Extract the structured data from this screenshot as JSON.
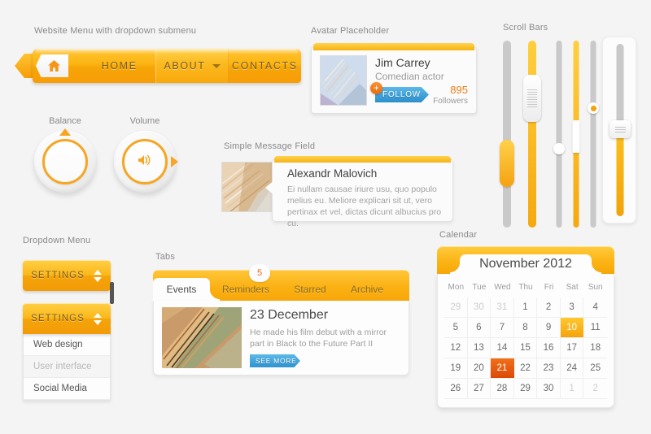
{
  "labels": {
    "menu": "Website Menu with dropdown submenu",
    "avatar": "Avatar Placeholder",
    "scrollbars": "Scroll Bars",
    "balance": "Balance",
    "volume": "Volume",
    "message": "Simple Message Field",
    "dropdown": "Dropdown Menu",
    "tabs": "Tabs",
    "calendar": "Calendar"
  },
  "menu": {
    "home_icon": "home-icon",
    "items": [
      {
        "label": "HOME",
        "active": false,
        "caret": false
      },
      {
        "label": "ABOUT",
        "active": true,
        "caret": true
      },
      {
        "label": "CONTACTS",
        "active": false,
        "caret": false
      }
    ]
  },
  "avatar": {
    "name": "Jim Carrey",
    "role": "Comedian actor",
    "follow_label": "FOLLOW",
    "plus_icon": "+",
    "followers_count": "895",
    "followers_label": "Followers"
  },
  "message": {
    "name": "Alexandr Malovich",
    "text": "Ei nullam causae iriure usu, quo populo melius eu. Meliore explicari sit ut, vero pertinax et vel, dictas dicunt albucius pro cu."
  },
  "dropdown": {
    "closed_label": "SETTINGS",
    "open_label": "SETTINGS",
    "items": [
      {
        "label": "Web design",
        "muted": false
      },
      {
        "label": "User interface",
        "muted": true
      },
      {
        "label": "Social Media",
        "muted": false
      }
    ]
  },
  "tabs": {
    "badge": "5",
    "items": [
      {
        "label": "Events",
        "active": true
      },
      {
        "label": "Reminders",
        "active": false
      },
      {
        "label": "Starred",
        "active": false
      },
      {
        "label": "Archive",
        "active": false
      }
    ],
    "content": {
      "title": "23 December",
      "text": "He made his film debut with a mirror part in Black to the Future Part II",
      "button": "SEE MORE"
    }
  },
  "calendar": {
    "title": "November 2012",
    "dow": [
      "Mon",
      "Tue",
      "Wed",
      "Thu",
      "Fri",
      "Sat",
      "Sun"
    ],
    "cells": [
      {
        "d": "29",
        "s": "out"
      },
      {
        "d": "30",
        "s": "out"
      },
      {
        "d": "31",
        "s": "out"
      },
      {
        "d": "1",
        "s": ""
      },
      {
        "d": "2",
        "s": ""
      },
      {
        "d": "3",
        "s": ""
      },
      {
        "d": "4",
        "s": ""
      },
      {
        "d": "5",
        "s": ""
      },
      {
        "d": "6",
        "s": ""
      },
      {
        "d": "7",
        "s": ""
      },
      {
        "d": "8",
        "s": ""
      },
      {
        "d": "9",
        "s": ""
      },
      {
        "d": "10",
        "s": "hl"
      },
      {
        "d": "11",
        "s": ""
      },
      {
        "d": "12",
        "s": ""
      },
      {
        "d": "13",
        "s": ""
      },
      {
        "d": "14",
        "s": ""
      },
      {
        "d": "15",
        "s": ""
      },
      {
        "d": "16",
        "s": ""
      },
      {
        "d": "17",
        "s": ""
      },
      {
        "d": "18",
        "s": ""
      },
      {
        "d": "19",
        "s": ""
      },
      {
        "d": "20",
        "s": ""
      },
      {
        "d": "21",
        "s": "sel"
      },
      {
        "d": "22",
        "s": ""
      },
      {
        "d": "23",
        "s": ""
      },
      {
        "d": "24",
        "s": ""
      },
      {
        "d": "25",
        "s": ""
      },
      {
        "d": "26",
        "s": ""
      },
      {
        "d": "27",
        "s": ""
      },
      {
        "d": "28",
        "s": ""
      },
      {
        "d": "29",
        "s": ""
      },
      {
        "d": "30",
        "s": ""
      },
      {
        "d": "1",
        "s": "out"
      },
      {
        "d": "2",
        "s": "out"
      }
    ]
  },
  "scrollbars": [
    {
      "name": "slider-pill-gray",
      "track": "gray",
      "thumb": "pill",
      "pos": 56
    },
    {
      "name": "slider-grip-yellow",
      "track": "yellow",
      "thumb": "grip",
      "pos": 22
    },
    {
      "name": "slider-dot-gray",
      "track": "gray",
      "thumb": "dot",
      "pos": 58
    },
    {
      "name": "slider-bar-yellow",
      "track": "yellow",
      "thumb": "bar",
      "pos": 47
    },
    {
      "name": "slider-dotorange-gray",
      "track": "gray",
      "thumb": "dot-orange",
      "pos": 35
    },
    {
      "name": "slider-panel-split",
      "track": "split",
      "thumb": "square",
      "pos": 50
    }
  ],
  "colors": {
    "accent": "#f5a623",
    "accent_light": "#ffcf45",
    "selected": "#e05207",
    "blue": "#2e93d0",
    "track_gray": "#c9c9c9",
    "background": "#f4f4f4"
  },
  "knobs": {
    "balance_pointer": "top",
    "volume_pointer": "right",
    "volume_icon": "speaker-icon"
  }
}
